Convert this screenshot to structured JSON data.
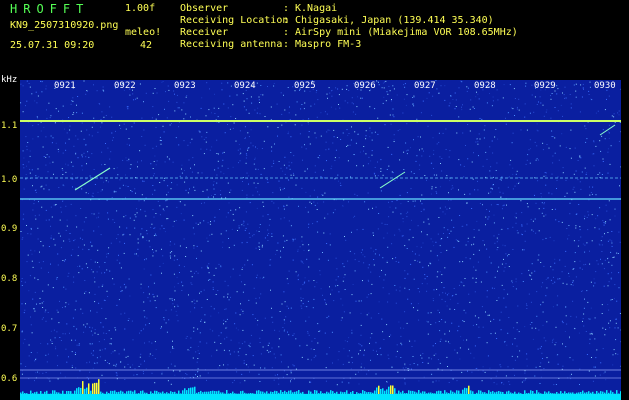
{
  "header": {
    "app_title": "HROFFT",
    "version": "1.00f",
    "file_name": "KN9_2507310920.png",
    "datetime": "25.07.31 09:20",
    "mode_label": "meleo!",
    "mode_count": "42"
  },
  "info": [
    {
      "label": "Observer",
      "value": "K.Nagai"
    },
    {
      "label": "Receiving Location",
      "value": "Chigasaki, Japan (139.414 35.340)"
    },
    {
      "label": "Receiver",
      "value": "AirSpy mini (Miakejima VOR 108.65MHz)"
    },
    {
      "label": "Receiving antenna",
      "value": "Maspro FM-3"
    }
  ],
  "axis": {
    "unit": "kHz",
    "y_ticks": [
      "1.1",
      "1.0",
      "0.9",
      "0.8",
      "0.7",
      "0.6"
    ],
    "x_ticks": [
      "0921",
      "0922",
      "0923",
      "0924",
      "0925",
      "0926",
      "0927",
      "0928",
      "0929",
      "0930"
    ]
  },
  "colors": {
    "background": "#000000",
    "spectrogram_bg": "#0a1fa0",
    "header_yellow": "#ffff55",
    "header_green": "#55ff55",
    "carrier_line": "#ccff66",
    "baseline": "#00e5ff"
  }
}
